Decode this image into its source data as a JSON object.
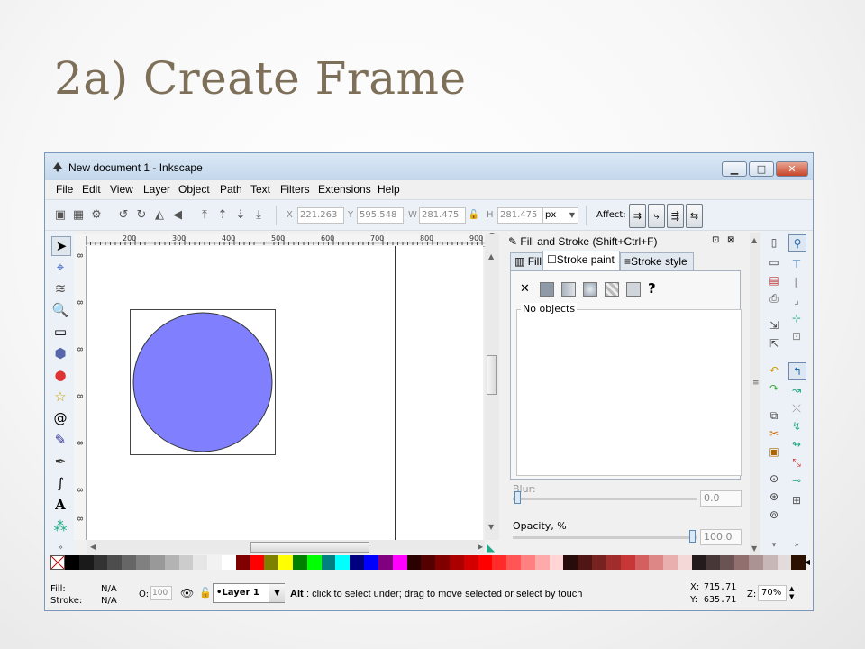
{
  "slide": {
    "title": "2a) Create Frame"
  },
  "window": {
    "title": "New document 1 - Inkscape",
    "minimize": "▁",
    "maximize": "□",
    "close": "✕"
  },
  "menu": [
    "File",
    "Edit",
    "View",
    "Layer",
    "Object",
    "Path",
    "Text",
    "Filters",
    "Extensions",
    "Help"
  ],
  "toolbar": {
    "x_label": "X",
    "x_value": "221.263",
    "y_label": "Y",
    "y_value": "595.548",
    "w_label": "W",
    "w_value": "281.475",
    "h_label": "H",
    "h_value": "281.475",
    "unit": "px",
    "affect_label": "Affect:"
  },
  "ruler": {
    "top": [
      "200",
      "300",
      "400",
      "500",
      "600",
      "700",
      "800",
      "900"
    ],
    "left": [
      "8",
      "8",
      "8",
      "8",
      "8",
      "8",
      "8",
      "8"
    ]
  },
  "panel": {
    "title": "Fill and Stroke (Shift+Ctrl+F)",
    "tabs": [
      "Fill",
      "Stroke paint",
      "Stroke style"
    ],
    "no_objects": "No objects",
    "unknown_mark": "?",
    "blur_label": "Blur:",
    "blur_value": "0.0",
    "opacity_label": "Opacity, %",
    "opacity_value": "100.0"
  },
  "canvas": {
    "circle_fill": "#8080ff",
    "circle_stroke": "#333333"
  },
  "palette": [
    "#000000",
    "#1a1a1a",
    "#333333",
    "#4d4d4d",
    "#666666",
    "#808080",
    "#999999",
    "#b3b3b3",
    "#cccccc",
    "#e6e6e6",
    "#f2f2f2",
    "#ffffff",
    "#800000",
    "#ff0000",
    "#808000",
    "#ffff00",
    "#008000",
    "#00ff00",
    "#008080",
    "#00ffff",
    "#000080",
    "#0000ff",
    "#800080",
    "#ff00ff",
    "#2b0000",
    "#550000",
    "#800000",
    "#aa0000",
    "#d40000",
    "#ff0000",
    "#ff2a2a",
    "#ff5555",
    "#ff8080",
    "#ffaaaa",
    "#ffd5d5",
    "#280b0b",
    "#501616",
    "#782121",
    "#a02c2c",
    "#c83737",
    "#d35f5f",
    "#de8787",
    "#e9afaf",
    "#f4d7d7",
    "#241c1c",
    "#483737",
    "#6c5353",
    "#916f6f",
    "#ac9393",
    "#c8b7b7",
    "#e3dbdb",
    "#2b1100"
  ],
  "status": {
    "fill_label": "Fill:",
    "fill_value": "N/A",
    "stroke_label": "Stroke:",
    "stroke_value": "N/A",
    "o_label": "O:",
    "o_value": "100",
    "layer": "•Layer 1",
    "message_bold": "Alt",
    "message": ": click to select under; drag to move selected or select by touch",
    "x_label": "X:",
    "x_value": "715.71",
    "y_label": "Y:",
    "y_value": "635.71",
    "z_label": "Z:",
    "zoom": "70%"
  }
}
